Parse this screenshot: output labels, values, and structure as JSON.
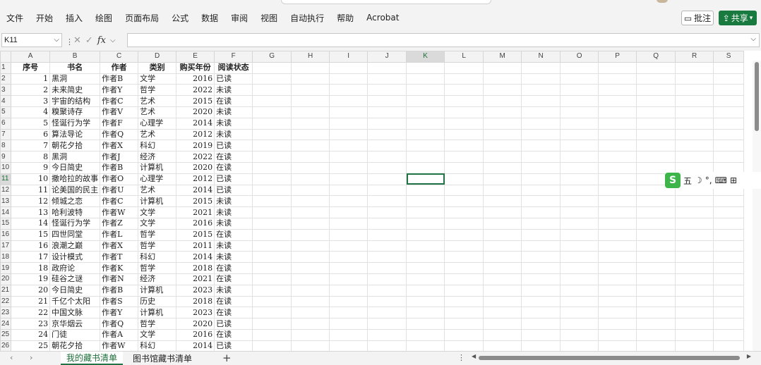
{
  "menu": [
    "文件",
    "开始",
    "插入",
    "绘图",
    "页面布局",
    "公式",
    "数据",
    "审阅",
    "视图",
    "自动执行",
    "帮助",
    "Acrobat"
  ],
  "buttons": {
    "comment": "批注",
    "share": "共享"
  },
  "formula_bar": {
    "name_box": "K11",
    "fx": "fx",
    "content": ""
  },
  "columns": [
    "A",
    "B",
    "C",
    "D",
    "E",
    "F",
    "G",
    "H",
    "I",
    "J",
    "K",
    "L",
    "M",
    "N",
    "O",
    "P",
    "Q",
    "R",
    "S"
  ],
  "active_cell": {
    "col": "K",
    "row": 11
  },
  "headers": [
    "序号",
    "书名",
    "作者",
    "类别",
    "购买年份",
    "阅读状态"
  ],
  "rows": [
    [
      1,
      "黑洞",
      "作者B",
      "文学",
      2016,
      "已读"
    ],
    [
      2,
      "未来简史",
      "作者Y",
      "哲学",
      2022,
      "未读"
    ],
    [
      3,
      "宇宙的结构",
      "作者C",
      "艺术",
      2015,
      "在读"
    ],
    [
      4,
      "糗聚诗存",
      "作者V",
      "艺术",
      2020,
      "未读"
    ],
    [
      5,
      "怪诞行为学",
      "作者F",
      "心理学",
      2014,
      "未读"
    ],
    [
      6,
      "算法导论",
      "作者Q",
      "艺术",
      2012,
      "未读"
    ],
    [
      7,
      "朝花夕拾",
      "作者X",
      "科幻",
      2019,
      "已读"
    ],
    [
      8,
      "黑洞",
      "作者J",
      "经济",
      2022,
      "在读"
    ],
    [
      9,
      "今日简史",
      "作者B",
      "计算机",
      2020,
      "在读"
    ],
    [
      10,
      "撒哈拉的故事",
      "作者O",
      "心理学",
      2012,
      "已读"
    ],
    [
      11,
      "论美国的民主",
      "作者U",
      "艺术",
      2014,
      "已读"
    ],
    [
      12,
      "倾城之恋",
      "作者C",
      "计算机",
      2015,
      "未读"
    ],
    [
      13,
      "哈利波特",
      "作者W",
      "文学",
      2021,
      "未读"
    ],
    [
      14,
      "怪诞行为学",
      "作者Z",
      "文学",
      2016,
      "未读"
    ],
    [
      15,
      "四世同堂",
      "作者L",
      "哲学",
      2015,
      "在读"
    ],
    [
      16,
      "浪潮之巅",
      "作者X",
      "哲学",
      2011,
      "未读"
    ],
    [
      17,
      "设计模式",
      "作者T",
      "科幻",
      2014,
      "未读"
    ],
    [
      18,
      "政府论",
      "作者K",
      "哲学",
      2018,
      "在读"
    ],
    [
      19,
      "硅谷之谜",
      "作者N",
      "经济",
      2021,
      "在读"
    ],
    [
      20,
      "今日简史",
      "作者B",
      "计算机",
      2023,
      "未读"
    ],
    [
      21,
      "千亿个太阳",
      "作者S",
      "历史",
      2018,
      "在读"
    ],
    [
      22,
      "中国文脉",
      "作者Y",
      "计算机",
      2023,
      "在读"
    ],
    [
      23,
      "京华烟云",
      "作者Q",
      "哲学",
      2020,
      "已读"
    ],
    [
      24,
      "门徒",
      "作者A",
      "文学",
      2016,
      "在读"
    ],
    [
      25,
      "朝花夕拾",
      "作者W",
      "科幻",
      2014,
      "已读"
    ]
  ],
  "ime_toolbar": {
    "logo": "S",
    "mode": "五",
    "moon": "☽",
    "punct": "°,",
    "keyboard": "⌨",
    "grid": "⊞"
  },
  "sheet_tabs": [
    "我的藏书清单",
    "图书馆藏书清单"
  ],
  "active_sheet": 0,
  "add_sheet": "+"
}
